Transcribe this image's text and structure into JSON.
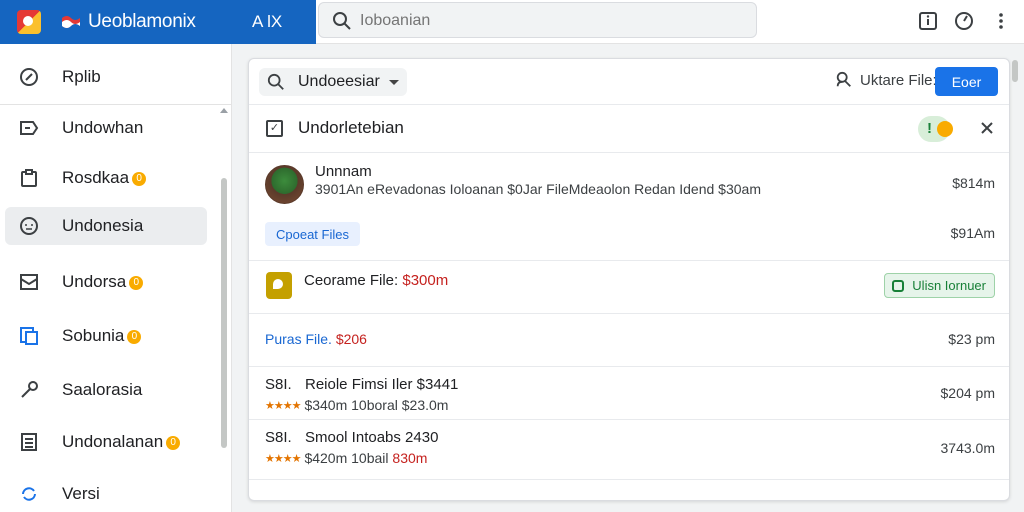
{
  "colors": {
    "brand": "#1565c0",
    "accent": "#1a73e8",
    "success": "#188038",
    "warning": "#f9ab00",
    "price_highlight": "#c5221f"
  },
  "header": {
    "app_title": "Ueoblamonix",
    "app_tag": "A lX",
    "search_placeholder": "Ioboanian",
    "icons": [
      "info-icon",
      "timer-icon",
      "more-vert-icon"
    ]
  },
  "sidebar": {
    "items": [
      {
        "label": "Rplib",
        "icon": "compass-icon",
        "badge": false,
        "active": false
      },
      {
        "label": "Undowhan",
        "icon": "label-icon",
        "badge": false,
        "active": false
      },
      {
        "label": "Rosdkaa",
        "icon": "clipboard-icon",
        "badge": true,
        "active": false
      },
      {
        "label": "Undonesia",
        "icon": "clock-face-icon",
        "badge": false,
        "active": true
      },
      {
        "label": "Undorsa",
        "icon": "inbox-icon",
        "badge": true,
        "active": false
      },
      {
        "label": "Sobunia",
        "icon": "pages-icon",
        "badge": true,
        "active": false
      },
      {
        "label": "Saalorasia",
        "icon": "key-icon",
        "badge": false,
        "active": false
      },
      {
        "label": "Undonalanan",
        "icon": "list-icon",
        "badge": true,
        "active": false
      },
      {
        "label": "Versi",
        "icon": "sync-icon",
        "badge": false,
        "active": false
      }
    ]
  },
  "toolbar": {
    "filter_label": "Undoeesiar",
    "update_label": "Uktare File:",
    "primary_label": "Eoer"
  },
  "section": {
    "title": "Undorletebian",
    "status_mark": "!"
  },
  "rows": {
    "person": {
      "name": "Unnnam",
      "description": "3901An eRevadonas Ioloanan $0Jar FileMdeaolon Redan Idend $30am",
      "price_top": "$814m",
      "action_label": "Cpoeat Files",
      "price_bottom": "$91Am"
    },
    "file": {
      "label": "Ceorame File:",
      "price": "$300m",
      "action_label": "Ulisn Iornuer"
    },
    "link": {
      "label": "Puras File.",
      "price": "$206",
      "time": "$23 pm"
    },
    "orders": [
      {
        "number": "S8I.",
        "title": "Reiole Fimsi Iler $3441",
        "stars": "★★★★",
        "sub_text": "$340m 10boral $23.0m",
        "sub_highlight": "",
        "time": "$204 pm"
      },
      {
        "number": "S8I.",
        "title": "Smool Intoabs 2430",
        "stars": "★★★★",
        "sub_text": "$420m 10bail",
        "sub_highlight": "830m",
        "time": "3743.0m"
      }
    ]
  }
}
